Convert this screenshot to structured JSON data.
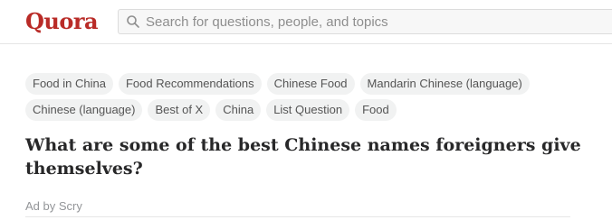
{
  "header": {
    "logo": "Quora",
    "search_placeholder": "Search for questions, people, and topics"
  },
  "topics": {
    "row1": [
      "Food in China",
      "Food Recommendations",
      "Chinese Food",
      "Mandarin Chinese (language)"
    ],
    "row2": [
      "Chinese (language)",
      "Best of X",
      "China",
      "List Question",
      "Food"
    ]
  },
  "question": {
    "title": "What are some of the best Chinese names foreigners give themselves?"
  },
  "ad": {
    "label": "Ad by Scry"
  },
  "colors": {
    "brand": "#b92b27",
    "topic_bg": "#f1f2f2"
  }
}
